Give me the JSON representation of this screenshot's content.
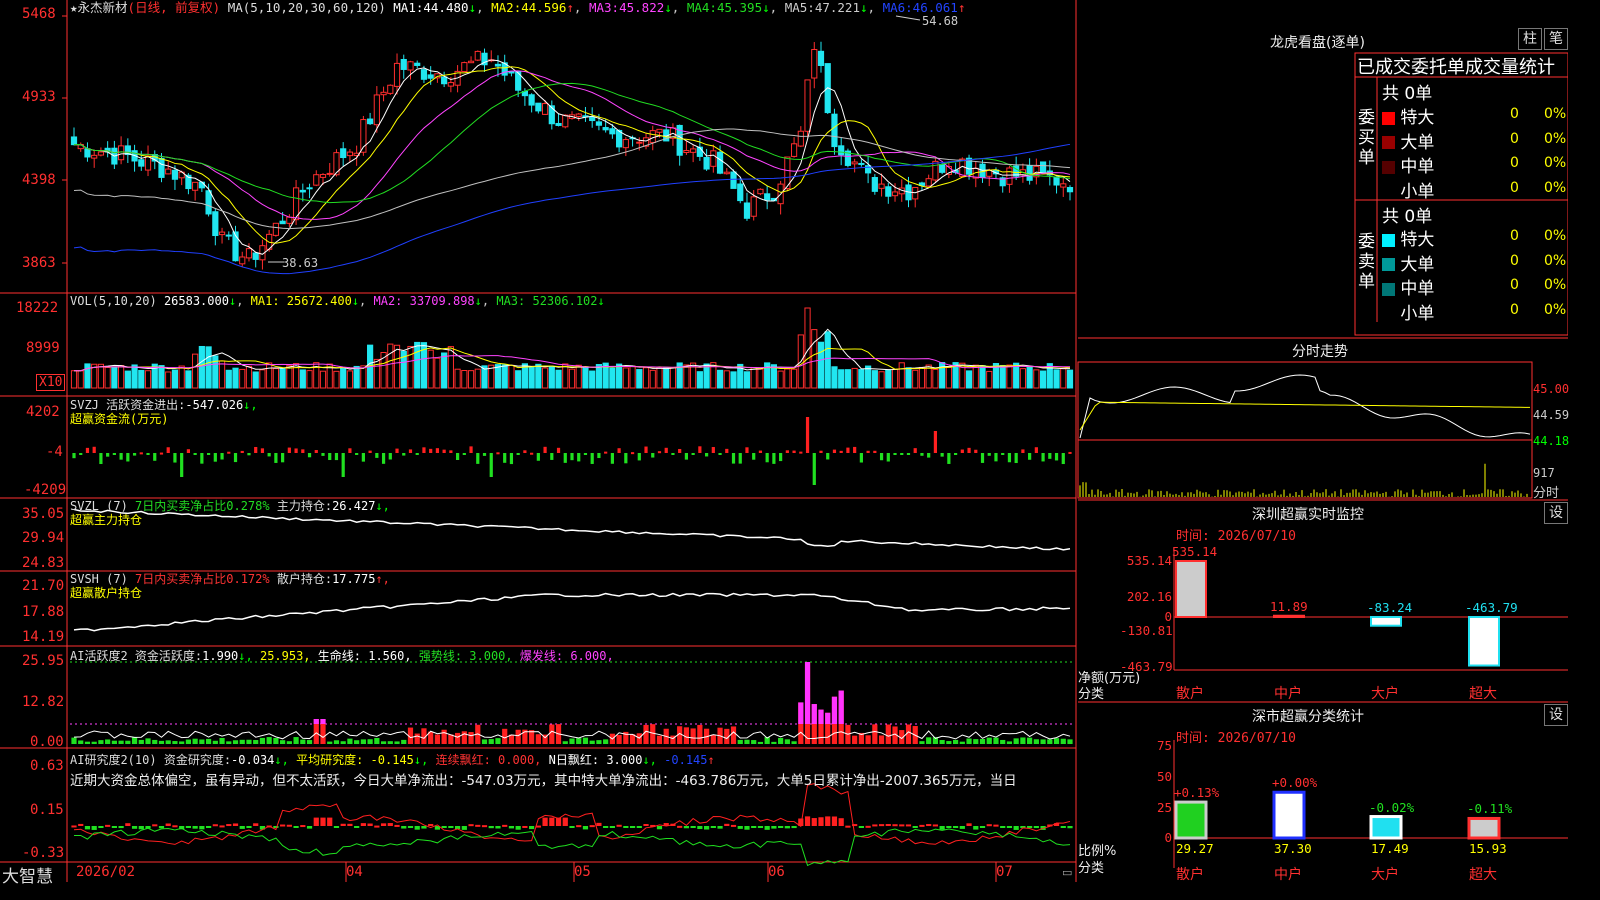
{
  "colors": {
    "up": "#ff2e2e",
    "down": "#21e6f0",
    "ma1": "#ffffff",
    "ma2": "#ffff00",
    "ma3": "#ff44ff",
    "ma4": "#22dd22",
    "ma5": "#c0c0c0",
    "ma6": "#2040ff",
    "grid": "#7a0000",
    "axis": "#ff3030",
    "flow_up": "#ff2020",
    "flow_down": "#20e020"
  },
  "header": {
    "star": "★",
    "stock": "永杰新材",
    "mode": "(日线, 前复权)",
    "ma_title": "MA(5,10,20,30,60,120)",
    "ma": [
      {
        "name": "MA1:",
        "value": "44.480",
        "arrow": "↓"
      },
      {
        "name": "MA2:",
        "value": "44.596",
        "arrow": "↑"
      },
      {
        "name": "MA3:",
        "value": "45.822",
        "arrow": "↓"
      },
      {
        "name": "MA4:",
        "value": "45.395",
        "arrow": "↓"
      },
      {
        "name": "MA5:",
        "value": "47.221",
        "arrow": "↓"
      },
      {
        "name": "MA6:",
        "value": "46.061",
        "arrow": "↑"
      }
    ]
  },
  "price_axis": [
    "5468",
    "4933",
    "4398",
    "3863"
  ],
  "price_marks": {
    "high": "54.68",
    "low": "38.63"
  },
  "vol": {
    "title": "VOL(5,10,20)",
    "value": "26583.000",
    "arrow": "↓",
    "ma1": "MA1: 25672.400",
    "ma2": "MA2: 33709.898",
    "ma3": "MA3: 52306.102",
    "axis": [
      "18222",
      "8999"
    ],
    "unit": "X10"
  },
  "svzj": {
    "title": "SVZJ",
    "label": "活跃资金进出:",
    "value": "-547.026",
    "arrow": "↓,",
    "sub": "超赢资金流(万元)",
    "axis": [
      "4202",
      "-4",
      "-4209"
    ]
  },
  "svzl": {
    "title": "SVZL (7)",
    "pct": "7日内买卖净占比0.278%",
    "label": "主力持仓:",
    "value": "26.427",
    "arrow": "↓,",
    "sub": "超赢主力持仓",
    "axis": [
      "35.05",
      "29.94",
      "24.83"
    ]
  },
  "svsh": {
    "title": "SVSH (7)",
    "pct": "7日内买卖净占比0.172%",
    "label": "散户持仓:",
    "value": "17.775",
    "arrow": "↑,",
    "sub": "超赢散户持仓",
    "axis": [
      "21.70",
      "17.88",
      "14.19"
    ]
  },
  "ai1": {
    "title": "AI活跃度2",
    "label": "资金活跃度:",
    "value": "1.990",
    "arrow": "↓,",
    "v2": "25.953,",
    "life": "生命线: 1.560,",
    "strong": "强势线: 3.000,",
    "burst": "爆发线: 6.000,",
    "axis": [
      "25.95",
      "12.82",
      "0.00"
    ]
  },
  "ai2": {
    "title": "AI研究度2(10)",
    "label": "资金研究度:",
    "value": "-0.034",
    "arrow": "↓,",
    "avg": "平均研究度: -0.145",
    "avg_arrow": "↓,",
    "red": "连续飘红: 0.000,",
    "nday": "N日飘红: 3.000",
    "nday_arrow": "↓,",
    "last": "-0.145",
    "last_arrow": "↑",
    "text": "近期大资金总体偏空，虽有异动，但不太活跃，今日大单净流出：-547.03万元，其中特大单净流出：-463.786万元，大单5日累计净出-2007.365万元，当日",
    "axis": [
      "0.63",
      "0.15",
      "-0.33"
    ]
  },
  "xaxis": {
    "labels": [
      "2026/02",
      "04",
      "05",
      "06",
      "07"
    ],
    "brand": "大智慧"
  },
  "chart_data": [
    {
      "type": "line",
      "title": "分时走势",
      "y_ticks": [
        "45.00",
        "44.59",
        "44.18"
      ],
      "vol_tick": "917",
      "vol_label": "分时"
    }
  ],
  "right": {
    "title": "龙虎看盘(逐单)",
    "btn1": "柱",
    "btn2": "笔",
    "table_title": "已成交委托单成交量统计",
    "buy": {
      "side": "委买单",
      "total": "共 0单",
      "rows": [
        {
          "label": "特大",
          "n": "0",
          "p": "0%",
          "c": "#ff0000"
        },
        {
          "label": "大单",
          "n": "0",
          "p": "0%",
          "c": "#990000"
        },
        {
          "label": "中单",
          "n": "0",
          "p": "0%",
          "c": "#550000"
        },
        {
          "label": "小单",
          "n": "0",
          "p": "0%",
          "c": "#000000"
        }
      ]
    },
    "sell": {
      "side": "委卖单",
      "total": "共 0单",
      "rows": [
        {
          "label": "特大",
          "n": "0",
          "p": "0%",
          "c": "#00f0ff"
        },
        {
          "label": "大单",
          "n": "0",
          "p": "0%",
          "c": "#009999"
        },
        {
          "label": "中单",
          "n": "0",
          "p": "0%",
          "c": "#007777"
        },
        {
          "label": "小单",
          "n": "0",
          "p": "0%",
          "c": "#000000"
        }
      ]
    },
    "monitor": {
      "title": "深圳超赢实时监控",
      "btn": "设",
      "time": "时间: 2026/07/10",
      "ylabel": "净额(万元)",
      "xlabel": "分类",
      "axis": [
        "535.14",
        "202.16",
        "0",
        "-130.81",
        "-463.79"
      ],
      "bars": [
        {
          "cat": "散户",
          "value": 535.14,
          "label": "535.14"
        },
        {
          "cat": "中户",
          "value": 11.89,
          "label": "11.89"
        },
        {
          "cat": "大户",
          "value": -83.24,
          "label": "-83.24"
        },
        {
          "cat": "超大",
          "value": -463.79,
          "label": "-463.79"
        }
      ]
    },
    "category": {
      "title": "深市超赢分类统计",
      "btn": "设",
      "time": "时间: 2026/07/10",
      "ylabel": "比例%",
      "xlabel": "分类",
      "axis": [
        "75",
        "50",
        "25",
        "0"
      ],
      "bars": [
        {
          "cat": "散户",
          "value": 29.27,
          "label": "29.27",
          "chg": "+0.13%"
        },
        {
          "cat": "中户",
          "value": 37.3,
          "label": "37.30",
          "chg": "+0.00%"
        },
        {
          "cat": "大户",
          "value": 17.49,
          "label": "17.49",
          "chg": "-0.02%"
        },
        {
          "cat": "超大",
          "value": 15.93,
          "label": "15.93",
          "chg": "-0.11%"
        }
      ]
    }
  }
}
